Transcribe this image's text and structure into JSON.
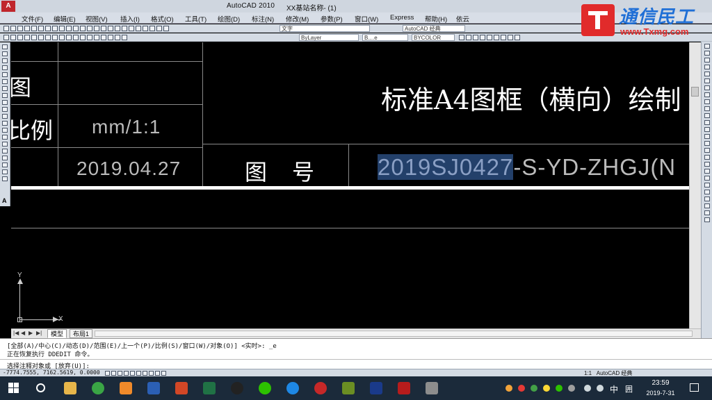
{
  "window": {
    "app_title": "AutoCAD 2010",
    "doc_title": "XX基站名称- (1)"
  },
  "menu": [
    {
      "label": "文件(F)"
    },
    {
      "label": "编辑(E)"
    },
    {
      "label": "视图(V)"
    },
    {
      "label": "插入(I)"
    },
    {
      "label": "格式(O)"
    },
    {
      "label": "工具(T)"
    },
    {
      "label": "绘图(D)"
    },
    {
      "label": "标注(N)"
    },
    {
      "label": "修改(M)"
    },
    {
      "label": "参数(P)"
    },
    {
      "label": "窗口(W)"
    },
    {
      "label": "Express"
    },
    {
      "label": "帮助(H)"
    },
    {
      "label": "依云"
    }
  ],
  "watermark": {
    "title": "通信民工",
    "url": "www.Txmg.com"
  },
  "toolbar": {
    "text_style": "文字",
    "workspace": "AutoCAD 经典",
    "layer_by": "ByLayer",
    "linetype": "B....e",
    "color": "BYCOLOR"
  },
  "drawing": {
    "label_tu": "图",
    "label_bili": "比例",
    "scale_value": "mm/1:1",
    "date_value": "2019.04.27",
    "title": "标准A4图框（横向）绘制",
    "label_tuhao": "图号",
    "number_selected": "2019SJ0427",
    "number_rest": "-S-YD-ZHGJ(N",
    "ucs_y": "Y",
    "ucs_x": "X"
  },
  "tabs": {
    "model": "模型",
    "layout1": "布局1"
  },
  "command": {
    "line1": "[全部(A)/中心(C)/动态(D)/范围(E)/上一个(P)/比例(S)/窗口(W)/对象(O)] <实时>: _e",
    "line2": "正在恢复执行 DDEDIT 命令。",
    "line3": "选择注释对象或 [放弃(U)]:"
  },
  "status": {
    "coords": "-7774.7555, 7162.5619, 0.0000",
    "annotation_scale": "1:1",
    "workspace": "AutoCAD 经典"
  },
  "taskbar": {
    "ime": "中",
    "ime2": "囲",
    "time": "23:59",
    "date": "2019-7-31"
  }
}
